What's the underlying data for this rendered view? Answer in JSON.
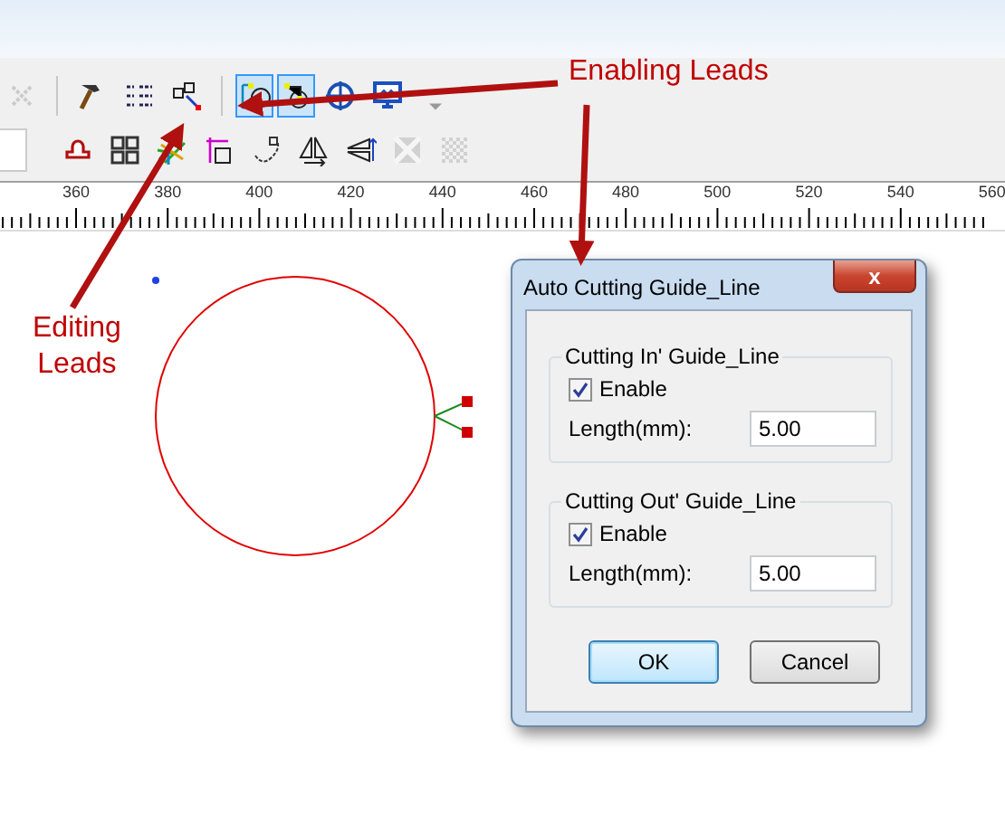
{
  "toolbar": {
    "rows": [
      {
        "buttons": [
          {
            "kind": "cut-x",
            "selected": false,
            "disabled": true
          },
          {
            "kind": "separator"
          },
          {
            "kind": "hammer",
            "selected": false,
            "disabled": false
          },
          {
            "kind": "list",
            "selected": false,
            "disabled": false
          },
          {
            "kind": "nodes",
            "selected": false,
            "disabled": false
          },
          {
            "kind": "separator"
          },
          {
            "kind": "lead-edit",
            "selected": true,
            "disabled": false
          },
          {
            "kind": "lead-enable",
            "selected": true,
            "disabled": false
          },
          {
            "kind": "target",
            "selected": false,
            "disabled": false
          },
          {
            "kind": "monitor",
            "selected": false,
            "disabled": false
          },
          {
            "kind": "caret",
            "selected": false,
            "disabled": false
          }
        ]
      },
      {
        "buttons": [
          {
            "kind": "field"
          },
          {
            "kind": "cloud",
            "selected": false,
            "disabled": false
          },
          {
            "kind": "grid",
            "selected": false,
            "disabled": false
          },
          {
            "kind": "color-lines",
            "selected": false,
            "disabled": false
          },
          {
            "kind": "corner",
            "selected": false,
            "disabled": false
          },
          {
            "kind": "path",
            "selected": false,
            "disabled": false
          },
          {
            "kind": "mirror-h",
            "selected": false,
            "disabled": false
          },
          {
            "kind": "mirror-v",
            "selected": false,
            "disabled": false
          },
          {
            "kind": "fill",
            "selected": false,
            "disabled": true
          },
          {
            "kind": "pattern",
            "selected": false,
            "disabled": true
          }
        ]
      }
    ]
  },
  "ruler": {
    "labels": [
      "360",
      "380",
      "400",
      "420",
      "440",
      "460",
      "480",
      "500",
      "520",
      "540",
      "560"
    ]
  },
  "dialog": {
    "title": "Auto Cutting Guide_Line",
    "close": "x",
    "groups": [
      {
        "title": "Cutting In' Guide_Line",
        "enable_label": "Enable",
        "checked": true,
        "length_label": "Length(mm):",
        "length": "5.00"
      },
      {
        "title": "Cutting Out' Guide_Line",
        "enable_label": "Enable",
        "checked": true,
        "length_label": "Length(mm):",
        "length": "5.00"
      }
    ],
    "buttons": [
      {
        "label": "OK",
        "selected": true
      },
      {
        "label": "Cancel",
        "selected": false
      }
    ]
  },
  "annotations": [
    {
      "kind": "enabling",
      "text": "Enabling Leads"
    },
    {
      "kind": "editing",
      "text": "Editing\nLeads"
    }
  ]
}
